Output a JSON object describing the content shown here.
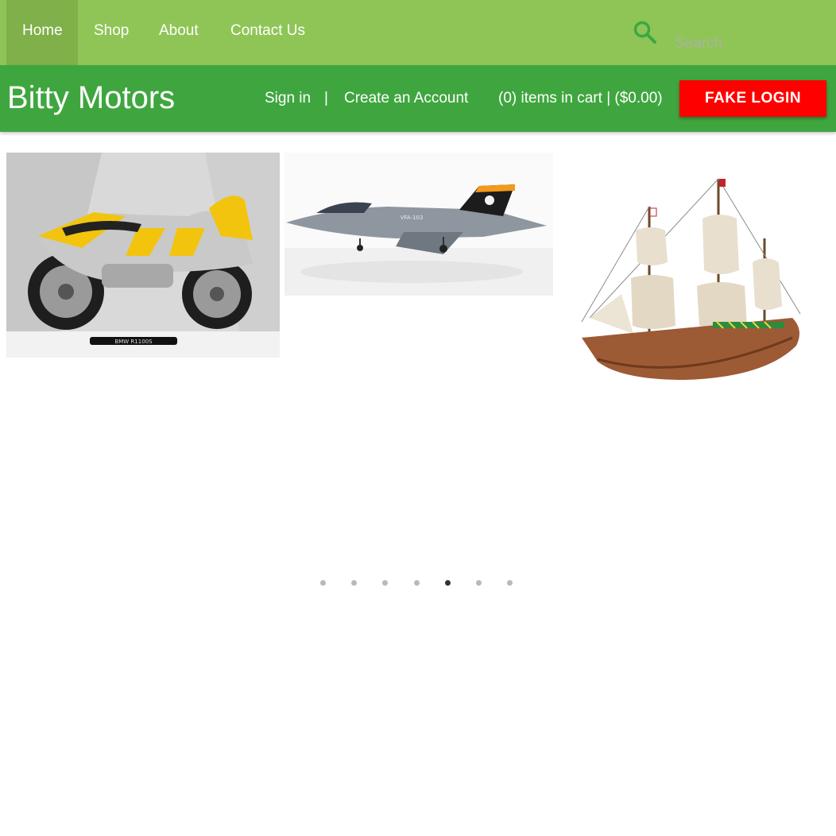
{
  "nav": {
    "items": [
      {
        "label": "Home",
        "active": true
      },
      {
        "label": "Shop",
        "active": false
      },
      {
        "label": "About",
        "active": false
      },
      {
        "label": "Contact Us",
        "active": false
      }
    ],
    "search": {
      "placeholder": "Search",
      "icon": "search-icon"
    }
  },
  "brand": {
    "title": "Bitty Motors",
    "sign_in": "Sign in",
    "separator": "|",
    "create_account": "Create an Account",
    "cart": "(0) items in cart | ($0.00)",
    "login_button": "FAKE LOGIN"
  },
  "carousel": {
    "slides": [
      {
        "name": "motorcycle-model",
        "caption": "BMW R1100S"
      },
      {
        "name": "fighter-jet-model",
        "caption": "VFA-103"
      },
      {
        "name": "sailing-ship-model"
      }
    ],
    "dot_count": 7,
    "active_dot": 5
  },
  "colors": {
    "nav_bg": "#8fc556",
    "nav_active_bg": "#7fb04a",
    "brand_bg": "#3fa63f",
    "login_bg": "#ff0000",
    "search_icon": "#3fa63f"
  }
}
